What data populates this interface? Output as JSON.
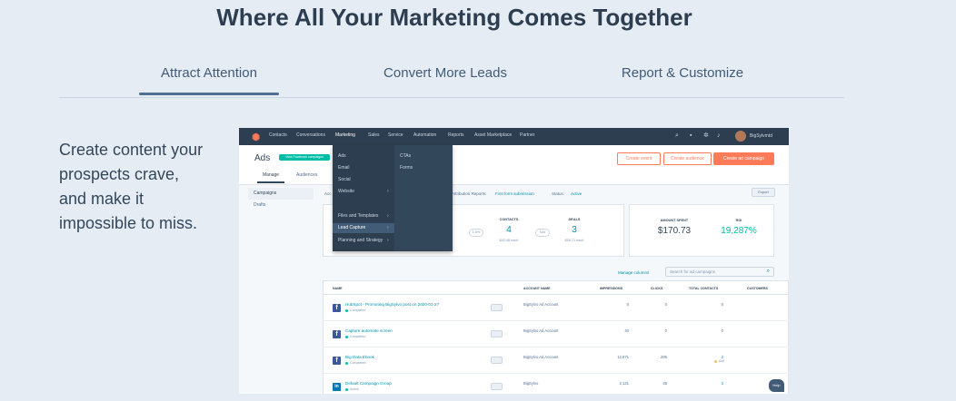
{
  "heading": "Where All Your Marketing Comes Together",
  "tabs": [
    {
      "label": "Attract Attention",
      "active": true
    },
    {
      "label": "Convert More Leads",
      "active": false
    },
    {
      "label": "Report & Customize",
      "active": false
    }
  ],
  "description": "Create content your prospects crave, and make it impossible to miss.",
  "app": {
    "topnav": {
      "items": [
        "Contacts",
        "Conversations",
        "Marketing",
        "Sales",
        "Service",
        "Automation",
        "Reports",
        "Asset Marketplace",
        "Partner"
      ],
      "active": "Marketing",
      "account": "BigSylvmtd"
    },
    "dropdown": {
      "items": [
        "Ads",
        "Email",
        "Social",
        "Website",
        "Files and Templates",
        "Lead Capture",
        "Planning and Strategy"
      ],
      "highlighted": "Lead Capture",
      "sub_items": [
        "CTAs",
        "Forms"
      ]
    },
    "page_title": "Ads",
    "new_badge": "View Facebook campaigns",
    "subtabs": [
      "Manage",
      "Audiences"
    ],
    "header_buttons": {
      "create_event": "Create event",
      "create_audience": "Create audience",
      "create_ad": "Create ad campaign"
    },
    "leftnav": [
      "Campaigns",
      "Drafts"
    ],
    "filters": {
      "account_prefix": "Acc",
      "attribution_label": "Attribution Reports:",
      "attribution_value": "First form submission",
      "status_label": "Status:",
      "status_value": "Active"
    },
    "export_label": "Export",
    "stats": {
      "pill1": "1.5%",
      "contacts_label": "CONTACTS",
      "contacts_value": "4",
      "contacts_sub": "$42.48 each",
      "pill2": "N/A",
      "deals_label": "DEALS",
      "deals_value": "3",
      "deals_sub": "$56.71 each",
      "spent_label": "AMOUNT SPENT",
      "spent_value": "$170.73",
      "roi_label": "ROI",
      "roi_value": "19,287%"
    },
    "manage_columns": "Manage columns",
    "search_placeholder": "Search for ad campaigns",
    "table": {
      "columns": [
        "NAME",
        "ACCOUNT NAME",
        "IMPRESSIONS",
        "CLICKS",
        "TOTAL CONTACTS",
        "CUSTOMERS"
      ],
      "rows": [
        {
          "network": "f",
          "name": "HubSpot - Promoting BigSylvo post on 2020-01-27",
          "status": "Completed",
          "account": "BigSylvo Ad Account",
          "impressions": "0",
          "clicks": "0",
          "contacts": "0",
          "contacts_sub": ""
        },
        {
          "network": "f",
          "name": "Capture automate screen",
          "status": "Completed",
          "account": "BigSylvo Ad Account",
          "impressions": "40",
          "clicks": "0",
          "contacts": "0",
          "contacts_sub": ""
        },
        {
          "network": "f",
          "name": "Big Data Ebook",
          "status": "Completed",
          "account": "BigSylvo Ad Account",
          "impressions": "12,871",
          "clicks": "285",
          "contacts": "3",
          "contacts_sub": "Add"
        },
        {
          "network": "in",
          "name": "Default Campaign Group",
          "status": "Active",
          "account": "BigSylvo",
          "impressions": "2,121",
          "clicks": "28",
          "contacts": "3",
          "contacts_sub": ""
        }
      ]
    },
    "help_label": "Help"
  }
}
